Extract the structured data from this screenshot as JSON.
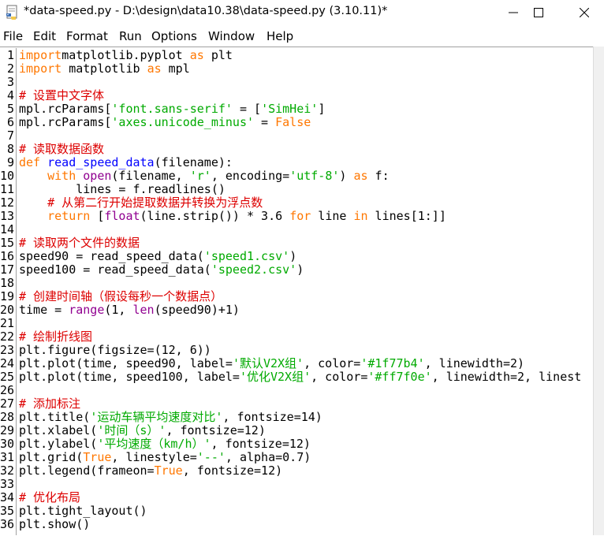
{
  "window": {
    "title": "*data-speed.py - D:\\design\\data10.38\\data-speed.py (3.10.11)*",
    "minimize_symbol": "—",
    "maximize_symbol": "☐",
    "close_symbol": "✕"
  },
  "menu": [
    "File",
    "Edit",
    "Format",
    "Run",
    "Options",
    "Window",
    "Help"
  ],
  "icons": {
    "app": "python-idle-icon",
    "minimize": "minimize-icon",
    "maximize": "maximize-icon",
    "close": "close-icon"
  },
  "colors": {
    "keyword": "#ff7700",
    "builtin": "#900090",
    "string": "#00aa00",
    "comment": "#dd0000",
    "definition": "#0000ff"
  },
  "code": [
    {
      "n": "1",
      "t": [
        [
          "kw",
          "import"
        ],
        [
          "",
          "matplotlib.pyplot "
        ],
        [
          "kw",
          "as"
        ],
        [
          "",
          " plt"
        ]
      ]
    },
    {
      "n": "2",
      "t": [
        [
          "kw",
          "import"
        ],
        [
          "",
          " matplotlib "
        ],
        [
          "kw",
          "as"
        ],
        [
          "",
          " mpl"
        ]
      ]
    },
    {
      "n": "3",
      "t": []
    },
    {
      "n": "4",
      "t": [
        [
          "cm",
          "# 设置中文字体"
        ]
      ]
    },
    {
      "n": "5",
      "t": [
        [
          "",
          "mpl.rcParams["
        ],
        [
          "st",
          "'font.sans-serif'"
        ],
        [
          "",
          " = ["
        ],
        [
          "st",
          "'SimHei'"
        ],
        [
          "",
          "]"
        ]
      ]
    },
    {
      "n": "6",
      "t": [
        [
          "",
          "mpl.rcParams["
        ],
        [
          "st",
          "'axes.unicode_minus'"
        ],
        [
          "",
          " = "
        ],
        [
          "kw",
          "False"
        ]
      ]
    },
    {
      "n": "7",
      "t": []
    },
    {
      "n": "8",
      "t": [
        [
          "cm",
          "# 读取数据函数"
        ]
      ]
    },
    {
      "n": "9",
      "t": [
        [
          "kw",
          "def"
        ],
        [
          "",
          " "
        ],
        [
          "df",
          "read_speed_data"
        ],
        [
          "",
          "(filename):"
        ]
      ]
    },
    {
      "n": "10",
      "t": [
        [
          "",
          "    "
        ],
        [
          "kw",
          "with"
        ],
        [
          "",
          " "
        ],
        [
          "bi",
          "open"
        ],
        [
          "",
          "(filename, "
        ],
        [
          "st",
          "'r'"
        ],
        [
          "",
          ", encoding="
        ],
        [
          "st",
          "'utf-8'"
        ],
        [
          "",
          ") "
        ],
        [
          "kw",
          "as"
        ],
        [
          "",
          " f:"
        ]
      ]
    },
    {
      "n": "11",
      "t": [
        [
          "",
          "        lines = f.readlines()"
        ]
      ]
    },
    {
      "n": "12",
      "t": [
        [
          "",
          "    "
        ],
        [
          "cm",
          "# 从第二行开始提取数据并转换为浮点数"
        ]
      ]
    },
    {
      "n": "13",
      "t": [
        [
          "",
          "    "
        ],
        [
          "kw",
          "return"
        ],
        [
          "",
          " ["
        ],
        [
          "bi",
          "float"
        ],
        [
          "",
          "(line.strip()) * 3.6 "
        ],
        [
          "kw",
          "for"
        ],
        [
          "",
          " line "
        ],
        [
          "kw",
          "in"
        ],
        [
          "",
          " lines[1:]]"
        ]
      ]
    },
    {
      "n": "14",
      "t": []
    },
    {
      "n": "15",
      "t": [
        [
          "cm",
          "# 读取两个文件的数据"
        ]
      ]
    },
    {
      "n": "16",
      "t": [
        [
          "",
          "speed90 = read_speed_data("
        ],
        [
          "st",
          "'speed1.csv'"
        ],
        [
          "",
          ")"
        ]
      ]
    },
    {
      "n": "17",
      "t": [
        [
          "",
          "speed100 = read_speed_data("
        ],
        [
          "st",
          "'speed2.csv'"
        ],
        [
          "",
          ")"
        ]
      ]
    },
    {
      "n": "18",
      "t": []
    },
    {
      "n": "19",
      "t": [
        [
          "cm",
          "# 创建时间轴（假设每秒一个数据点）"
        ]
      ]
    },
    {
      "n": "20",
      "t": [
        [
          "",
          "time = "
        ],
        [
          "bi",
          "range"
        ],
        [
          "",
          "(1, "
        ],
        [
          "bi",
          "len"
        ],
        [
          "",
          "(speed90)+1)"
        ]
      ]
    },
    {
      "n": "21",
      "t": []
    },
    {
      "n": "22",
      "t": [
        [
          "cm",
          "# 绘制折线图"
        ]
      ]
    },
    {
      "n": "23",
      "t": [
        [
          "",
          "plt.figure(figsize=(12, 6))"
        ]
      ]
    },
    {
      "n": "24",
      "t": [
        [
          "",
          "plt.plot(time, speed90, label="
        ],
        [
          "st",
          "'默认V2X组'"
        ],
        [
          "",
          ", color="
        ],
        [
          "st",
          "'#1f77b4'"
        ],
        [
          "",
          ", linewidth=2)"
        ]
      ]
    },
    {
      "n": "25",
      "t": [
        [
          "",
          "plt.plot(time, speed100, label="
        ],
        [
          "st",
          "'优化V2X组'"
        ],
        [
          "",
          ", color="
        ],
        [
          "st",
          "'#ff7f0e'"
        ],
        [
          "",
          ", linewidth=2, linest"
        ]
      ]
    },
    {
      "n": "26",
      "t": []
    },
    {
      "n": "27",
      "t": [
        [
          "cm",
          "# 添加标注"
        ]
      ]
    },
    {
      "n": "28",
      "t": [
        [
          "",
          "plt.title("
        ],
        [
          "st",
          "'运动车辆平均速度对比'"
        ],
        [
          "",
          ", fontsize=14)"
        ]
      ]
    },
    {
      "n": "29",
      "t": [
        [
          "",
          "plt.xlabel("
        ],
        [
          "st",
          "'时间（s）'"
        ],
        [
          "",
          ", fontsize=12)"
        ]
      ]
    },
    {
      "n": "30",
      "t": [
        [
          "",
          "plt.ylabel("
        ],
        [
          "st",
          "'平均速度（km/h）'"
        ],
        [
          "",
          ", fontsize=12)"
        ]
      ]
    },
    {
      "n": "31",
      "t": [
        [
          "",
          "plt.grid("
        ],
        [
          "kw",
          "True"
        ],
        [
          "",
          ", linestyle="
        ],
        [
          "st",
          "'--'"
        ],
        [
          "",
          ", alpha=0.7)"
        ]
      ]
    },
    {
      "n": "32",
      "t": [
        [
          "",
          "plt.legend(frameon="
        ],
        [
          "kw",
          "True"
        ],
        [
          "",
          ", fontsize=12)"
        ]
      ]
    },
    {
      "n": "33",
      "t": []
    },
    {
      "n": "34",
      "t": [
        [
          "cm",
          "# 优化布局"
        ]
      ]
    },
    {
      "n": "35",
      "t": [
        [
          "",
          "plt.tight_layout()"
        ]
      ]
    },
    {
      "n": "36",
      "t": [
        [
          "",
          "plt.show()"
        ]
      ]
    }
  ]
}
